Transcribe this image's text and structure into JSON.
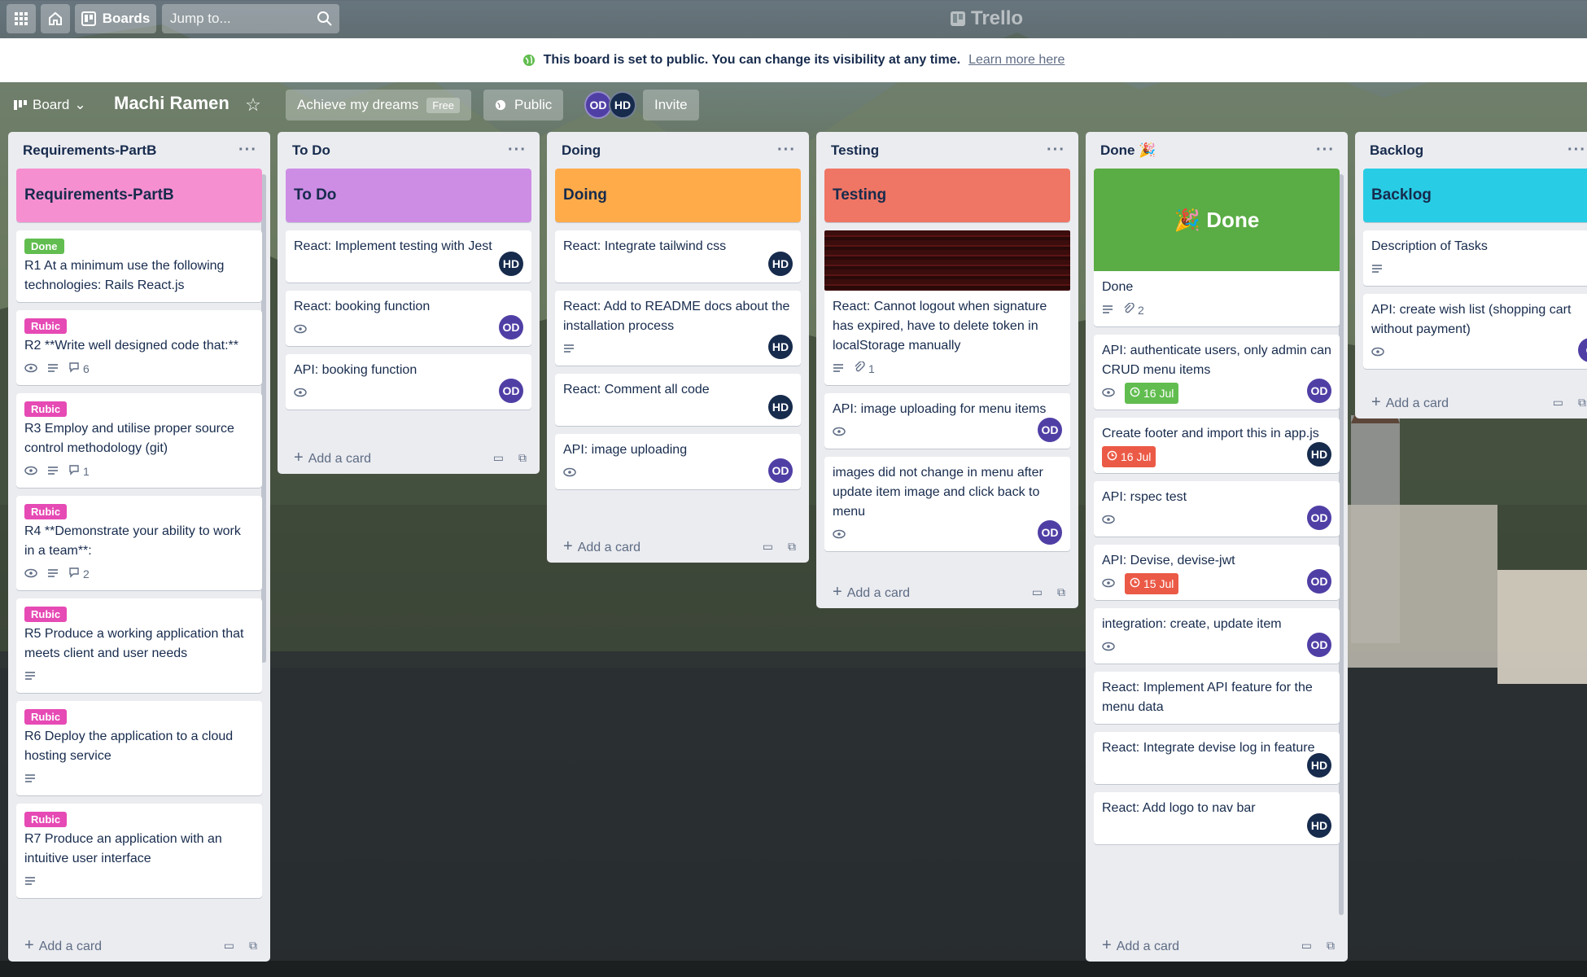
{
  "topbar": {
    "boards_label": "Boards",
    "search_placeholder": "Jump to...",
    "logo": "Trello"
  },
  "banner": {
    "text": "This board is set to public. You can change its visibility at any time.",
    "link": "Learn more here"
  },
  "board": {
    "view_label": "Board",
    "title": "Machi Ramen",
    "team": "Achieve my dreams",
    "team_badge": "Free",
    "visibility": "Public",
    "invite": "Invite",
    "members": [
      "OD",
      "HD"
    ]
  },
  "colors": {
    "od": "#4f3fa5",
    "hd": "#172b4d",
    "done_label": "#61bd4f",
    "rubic_label": "#e64ab4",
    "due_green": "#61bd4f",
    "due_red": "#eb5a46"
  },
  "lists": [
    {
      "title": "Requirements-PartB",
      "cover_title": "Requirements-PartB",
      "cover_color": "#f58fd0",
      "cards": [
        {
          "label": "Done",
          "text": "R1 At a minimum use the following technologies: Rails React.js",
          "badges": ""
        },
        {
          "label": "Rubic",
          "text": "R2 **Write well designed code that:**",
          "comments": "6"
        },
        {
          "label": "Rubic",
          "text": "R3 Employ and utilise proper source control methodology (git)",
          "comments": "1"
        },
        {
          "label": "Rubic",
          "text": "R4 **Demonstrate your ability to work in a team**:",
          "comments": "2"
        },
        {
          "label": "Rubic",
          "text": "R5 Produce a working application that meets client and user needs"
        },
        {
          "label": "Rubic",
          "text": "R6 Deploy the application to a cloud hosting service"
        },
        {
          "label": "Rubic",
          "text": "R7 Produce an application with an intuitive user interface"
        }
      ],
      "add": "Add a card"
    },
    {
      "title": "To Do",
      "cover_title": "To Do",
      "cover_color": "#cd8de5",
      "cards": [
        {
          "text": "React: Implement testing with Jest",
          "member": "HD"
        },
        {
          "text": "React: booking function",
          "member": "OD"
        },
        {
          "text": "API: booking function",
          "member": "OD"
        }
      ],
      "add": "Add a card"
    },
    {
      "title": "Doing",
      "cover_title": "Doing",
      "cover_color": "#ffab4a",
      "cards": [
        {
          "text": "React: Integrate tailwind css",
          "member": "HD"
        },
        {
          "text": "React: Add to README docs about the installation process",
          "member": "HD"
        },
        {
          "text": "React: Comment all code",
          "member": "HD"
        },
        {
          "text": "API: image uploading",
          "member": "OD"
        }
      ],
      "add": "Add a card"
    },
    {
      "title": "Testing",
      "cover_title": "Testing",
      "cover_color": "#ef7564",
      "cards": [
        {
          "text": "React: Cannot logout when signature has expired, have to delete token in localStorage manually",
          "attachments": "1"
        },
        {
          "text": "API: image uploading for menu items",
          "member": "OD"
        },
        {
          "text": "images did not change in menu after update item image and click back to menu",
          "member": "OD"
        }
      ],
      "add": "Add a card"
    },
    {
      "title": "Done 🎉",
      "cover_title": "🎉 Done",
      "cover_color": "#5aac44",
      "cards": [
        {
          "text": "Done",
          "attachments": "2"
        },
        {
          "text": "API: authenticate users, only admin can CRUD menu items",
          "due": "16 Jul",
          "member": "OD"
        },
        {
          "text": "Create footer and import this in app.js",
          "due": "16 Jul",
          "member": "HD"
        },
        {
          "text": "API: rspec test",
          "member": "OD"
        },
        {
          "text": "API: Devise, devise-jwt",
          "due": "15 Jul",
          "member": "OD"
        },
        {
          "text": "integration: create, update item",
          "member": "OD"
        },
        {
          "text": "React: Implement API feature for the menu data"
        },
        {
          "text": "React: Integrate devise log in feature",
          "member": "HD"
        },
        {
          "text": "React: Add logo to nav bar",
          "member": "HD"
        }
      ],
      "add": "Add a card"
    },
    {
      "title": "Backlog",
      "cover_title": "Backlog",
      "cover_color": "#29cce5",
      "cards": [
        {
          "text": "Description of Tasks"
        },
        {
          "text": "API: create wish list (shopping cart without payment)",
          "member": "O"
        }
      ],
      "add": "Add a card"
    }
  ]
}
